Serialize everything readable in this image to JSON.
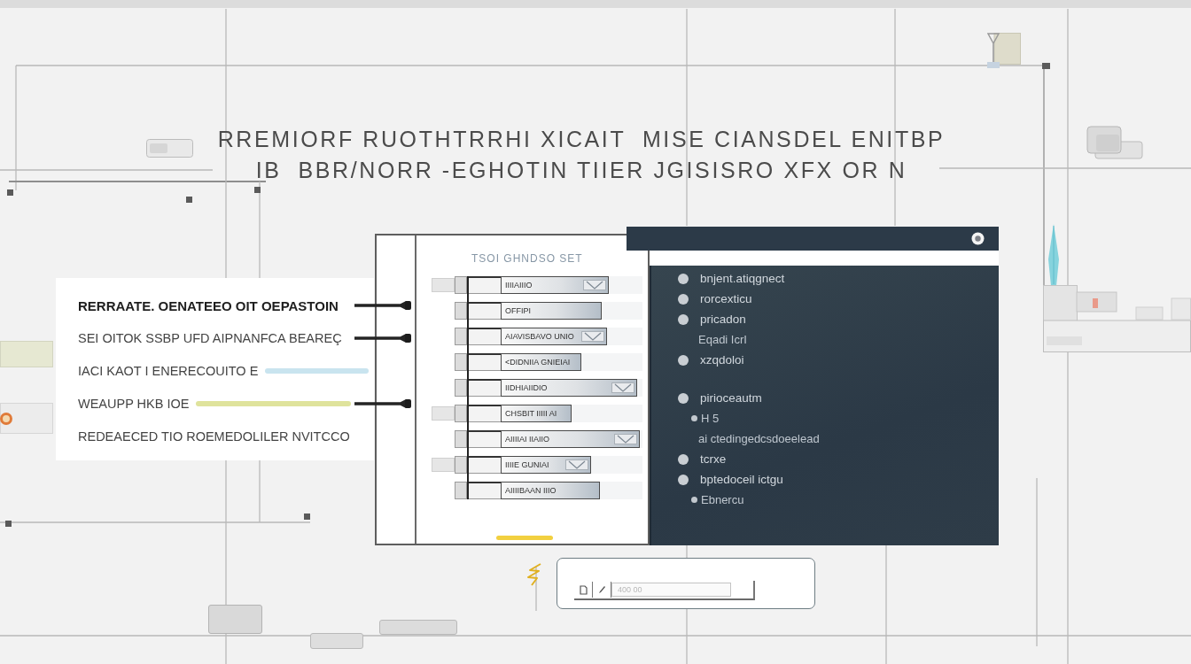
{
  "title": {
    "lines": [
      "RREMIORF RUOTHTRRHI XICAIT  MISE CIANSDEL ENITBP",
      "IB  BBR/NORR -EGHOTIN TIIER JGISISRO XFX OR N"
    ]
  },
  "callout": {
    "lines": [
      {
        "text": "RERRAATE. OENATEEO OIT OEPASTOIN",
        "bold": true,
        "linked": true
      },
      {
        "text": "SEI OITOK SSBP UFD AIPNANFCA BEAREÇ",
        "bold": false,
        "linked": true
      },
      {
        "text": "IACI KAOT I ENERECOUITO E",
        "bold": false,
        "linked": false,
        "color": "#c9e4ef"
      },
      {
        "text": "WEAUPP HKB IOE",
        "bold": false,
        "linked": true,
        "color": "#dfe39c"
      },
      {
        "text": "REDEAECED TIO ROEMEDOLILER NVITCCO",
        "bold": false,
        "linked": false
      }
    ]
  },
  "document": {
    "header": "TSOI GHNDSO SET",
    "rows": [
      {
        "label": "IIIIAIIIO",
        "level": 0.76,
        "stub": true,
        "marker": true
      },
      {
        "label": "OFFIPI",
        "level": 0.71,
        "stub": false,
        "marker": false
      },
      {
        "label": "AIAVISBAVO UNIO",
        "level": 0.75,
        "stub": false,
        "marker": true
      },
      {
        "label": "<DIDNIIA GNIEIAI",
        "level": 0.57,
        "stub": false,
        "marker": false
      },
      {
        "label": "IIDHIAIIDIO",
        "level": 0.96,
        "stub": false,
        "marker": true
      },
      {
        "label": "CHSBIT IIIII AI",
        "level": 0.5,
        "stub": true,
        "marker": false
      },
      {
        "label": "AIIIIAI IIAIIO",
        "level": 0.98,
        "stub": false,
        "marker": true
      },
      {
        "label": "IIIIE GUNIAI",
        "level": 0.64,
        "stub": true,
        "marker": true
      },
      {
        "label": "AIIIIBAAN IIIO",
        "level": 0.7,
        "stub": false,
        "marker": false
      }
    ]
  },
  "outline": {
    "groups": [
      [
        {
          "text": "bnjent.atiqgnect"
        },
        {
          "text": "rorcexticu"
        },
        {
          "text": "pricadon",
          "children": [
            {
              "text": "Eqadi IcrI",
              "bullet": false
            }
          ]
        },
        {
          "text": "xzqdoloi"
        }
      ],
      [
        {
          "text": "pirioceautm",
          "children": [
            {
              "text": "H 5",
              "bullet": true
            },
            {
              "text": "ai ctedingedcsdoeelead",
              "bullet": false
            }
          ]
        },
        {
          "text": "tcrxe"
        },
        {
          "text": "bptedoceil ictgu",
          "children": [
            {
              "text": "Ebnercu",
              "bullet": true
            }
          ]
        }
      ]
    ]
  },
  "input_box": {
    "placeholder": "400 00"
  }
}
